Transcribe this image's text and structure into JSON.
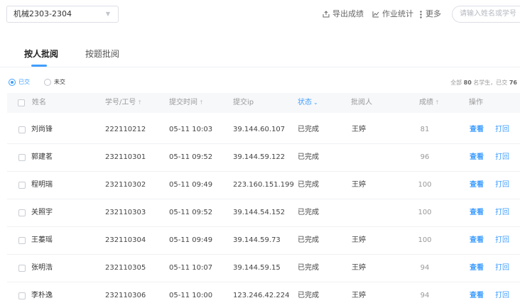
{
  "topbar": {
    "class_value": "机械2303-2304",
    "export_label": "导出成绩",
    "stats_label": "作业统计",
    "more_label": "更多",
    "search_placeholder": "请输入姓名或学号"
  },
  "tabs": [
    {
      "label": "按人批阅",
      "active": true
    },
    {
      "label": "按题批阅",
      "active": false
    }
  ],
  "filters": {
    "submitted_label": "已交",
    "not_submitted_label": "未交",
    "selected": "submitted"
  },
  "summary": {
    "prefix": "全部",
    "total": "80",
    "middle": "名学生，已交",
    "submitted": "76"
  },
  "table": {
    "headers": {
      "name": "姓名",
      "id": "学号/工号",
      "time": "提交时间",
      "ip": "提交ip",
      "status": "状态",
      "reviewer": "批阅人",
      "score": "成绩",
      "actions": "操作"
    },
    "view_label": "查看",
    "return_label": "打回",
    "rows": [
      {
        "name": "刘尚锋",
        "id": "222110212",
        "time": "05-11 10:03",
        "ip": "39.144.60.107",
        "status": "已完成",
        "reviewer": "王婷",
        "score": "81"
      },
      {
        "name": "郭建茗",
        "id": "232110301",
        "time": "05-11 09:52",
        "ip": "39.144.59.122",
        "status": "已完成",
        "reviewer": "",
        "score": "96"
      },
      {
        "name": "程明瑞",
        "id": "232110302",
        "time": "05-11 09:49",
        "ip": "223.160.151.199",
        "status": "已完成",
        "reviewer": "王婷",
        "score": "100"
      },
      {
        "name": "关照宇",
        "id": "232110303",
        "time": "05-11 09:52",
        "ip": "39.144.54.152",
        "status": "已完成",
        "reviewer": "",
        "score": "100"
      },
      {
        "name": "王蓁瑶",
        "id": "232110304",
        "time": "05-11 09:49",
        "ip": "39.144.59.73",
        "status": "已完成",
        "reviewer": "王婷",
        "score": "100"
      },
      {
        "name": "张明浩",
        "id": "232110305",
        "time": "05-11 10:07",
        "ip": "39.144.59.15",
        "status": "已完成",
        "reviewer": "王婷",
        "score": "94"
      },
      {
        "name": "李朴逸",
        "id": "232110306",
        "time": "05-11 10:00",
        "ip": "123.246.42.224",
        "status": "已完成",
        "reviewer": "王婷",
        "score": "94"
      }
    ]
  },
  "colors": {
    "accent": "#409eff",
    "muted": "#999999"
  }
}
